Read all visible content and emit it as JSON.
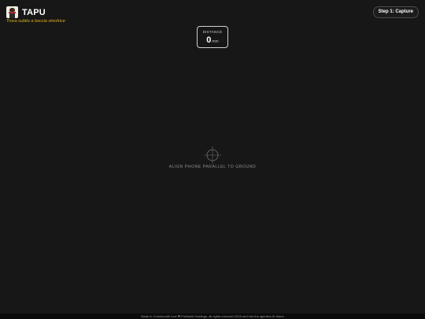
{
  "header": {
    "brand_name": "TAPU",
    "tagline": "Trova subito a boccia vincitrice",
    "logo_icon": "statue-logo-icon",
    "step_button_label": "Step 1: Capture"
  },
  "distance": {
    "label": "DISTANCE",
    "value": "0",
    "unit": "mm"
  },
  "viewfinder": {
    "reticle_icon": "crosshair-icon",
    "instruction": "ALIGN PHONE PARALLEL TO GROUND"
  },
  "footer": {
    "text": "Made in Corsica with love ❤ Portboriti Holdings, all rights reserved 2025 and into the agentics AI future"
  },
  "colors": {
    "background": "#171717",
    "tagline": "#e0b21a",
    "text": "#ffffff",
    "muted": "#8c8c8c"
  }
}
